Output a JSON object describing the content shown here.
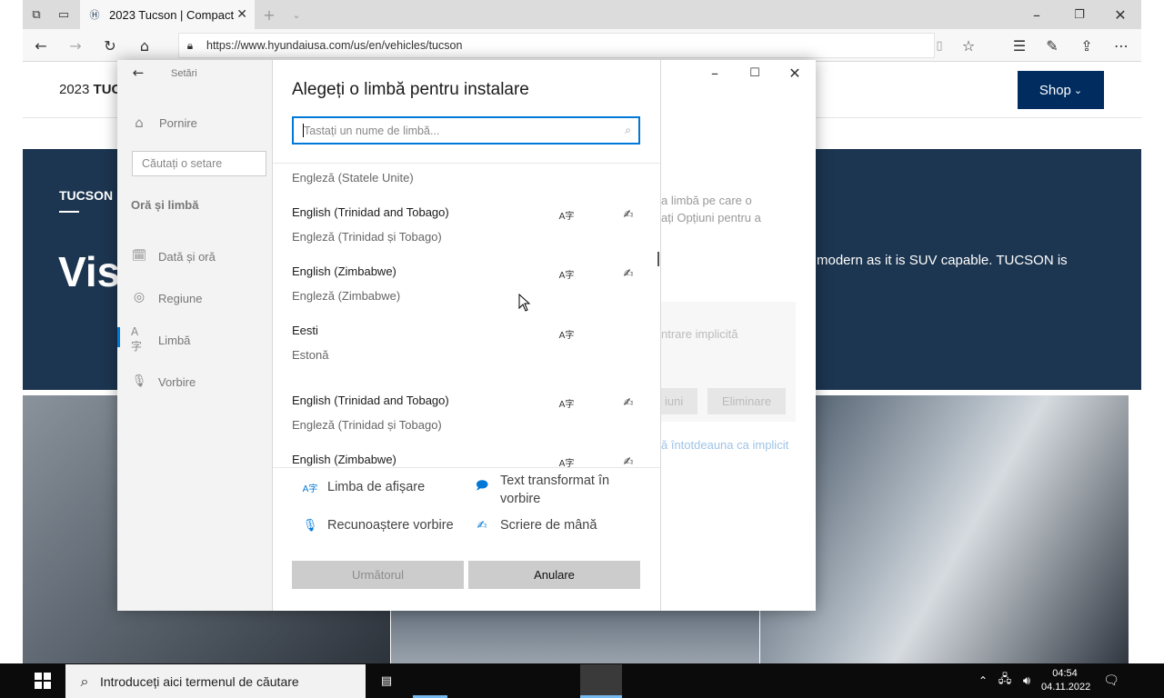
{
  "browser": {
    "tab_title": "2023 Tucson | Compact",
    "url": "https://www.hyundaiusa.com/us/en/vehicles/tucson"
  },
  "site": {
    "header_title_prefix": "2023 ",
    "header_title_bold": "TUC",
    "shop_label": "Shop",
    "hero_tag": "TUCSON",
    "hero_heading": "Vis",
    "hero_text": "modern as it is SUV capable. TUCSON is"
  },
  "settings": {
    "back_label": "Setări",
    "home_label": "Pornire",
    "search_placeholder": "Căutați o setare",
    "category": "Oră și limbă",
    "nav": [
      {
        "label": "Dată și oră",
        "icon": "calendar-clock-icon"
      },
      {
        "label": "Regiune",
        "icon": "globe-icon"
      },
      {
        "label": "Limbă",
        "icon": "language-icon"
      },
      {
        "label": "Vorbire",
        "icon": "microphone-icon"
      }
    ],
    "bg_text1": "a limbă pe care o",
    "bg_text2": "ați Opțiuni pentru a",
    "bg_text3": "ntrare implicită",
    "bg_btn1": "iuni",
    "bg_btn2": "Eliminare",
    "bg_link": "ă întotdeauna ca implicit"
  },
  "dialog": {
    "title": "Alegeți o limbă pentru instalare",
    "search_placeholder": "Tastați un nume de limbă...",
    "languages": [
      {
        "name": "",
        "sub": "Engleză (Statele Unite)"
      },
      {
        "name": "English (Trinidad and Tobago)",
        "sub": "Engleză (Trinidad și Tobago)"
      },
      {
        "name": "English (Zimbabwe)",
        "sub": "Engleză (Zimbabwe)"
      },
      {
        "name": "Eesti",
        "sub": "Estonă"
      },
      {
        "name": "English (Trinidad and Tobago)",
        "sub": "Engleză (Trinidad și Tobago)"
      },
      {
        "name": "English (Zimbabwe)",
        "sub": ""
      }
    ],
    "features": {
      "display": "Limba de afișare",
      "tts": "Text transformat în vorbire",
      "speech": "Recunoaștere vorbire",
      "handwriting": "Scriere de mână"
    },
    "next_label": "Următorul",
    "cancel_label": "Anulare"
  },
  "taskbar": {
    "search_placeholder": "Introduceți aici termenul de căutare",
    "time": "04:54",
    "date": "04.11.2022"
  },
  "colors": {
    "accent": "#0078d7",
    "hero": "#1c3550",
    "shop": "#002c5f"
  }
}
